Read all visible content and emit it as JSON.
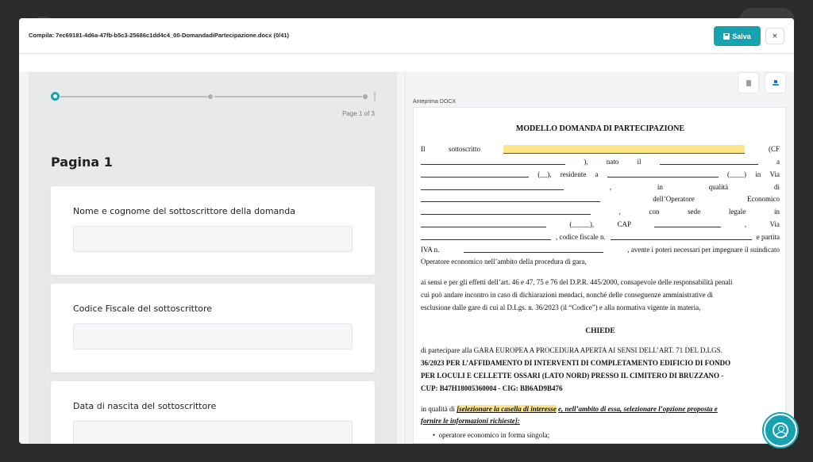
{
  "modal": {
    "title": "Compila: 7ec69181-4d6a-47fb-b5c3-25686c1dd4c4_00-DomandadiPartecipazione.docx (0/41)",
    "save_label": "Salva",
    "close_label": "×"
  },
  "form": {
    "page_counter": "Page 1 of 3",
    "page_heading": "Pagina 1",
    "fields": [
      {
        "label": "Nome e cognome del sottoscrittore della domanda",
        "value": ""
      },
      {
        "label": "Codice Fiscale del sottoscrittore",
        "value": ""
      },
      {
        "label": "Data di nascita del sottoscrittore",
        "value": ""
      }
    ]
  },
  "preview": {
    "label": "Anteprima DOCX",
    "doc_title": "MODELLO DOMANDA DI PARTECIPAZIONE",
    "l1_a": "Il",
    "l1_b": "sottoscritto",
    "l1_c": "(CF",
    "l2_a": "),",
    "l2_b": "nato",
    "l2_c": "il",
    "l2_d": "a",
    "l3_a": "(__),",
    "l3_b": "residente",
    "l3_c": "a",
    "l3_d": "(____)",
    "l3_e": "in",
    "l3_f": "Via",
    "l4_a": ",",
    "l4_b": "in",
    "l4_c": "qualità",
    "l4_d": "di",
    "l5_a": "dell’Operatore",
    "l5_b": "Economico",
    "l6_a": ",",
    "l6_b": "con",
    "l6_c": "sede",
    "l6_d": "legale",
    "l6_e": "in",
    "l7_a": "(_____),",
    "l7_b": "CAP",
    "l7_c": ",",
    "l7_d": "Via",
    "l8_a": ", codice fiscale n.",
    "l8_b": "e partita",
    "l9_a": "IVA n.",
    "l9_b": ", avente i poteri necessari per impegnare il suindicato",
    "l10": "Operatore economico nell’ambito della procedura di gara,",
    "p2_1": "ai sensi e per gli effetti dell’art. 46 e 47, 75 e 76 del D.P.R. 445/2000, consapevole delle responsabilità penali",
    "p2_2": "cui può andare incontro in caso di dichiarazioni mendaci, nonché delle conseguenze amministrative di",
    "p2_3": "esclusione dalle gare di cui al D.Lgs. n. 36/2023 (il “Codice”) e alla normativa vigente in materia,",
    "chiede": "CHIEDE",
    "p3_1": "di partecipare alla GARA EUROPEA A PROCEDURA APERTA AI SENSI DELL’ART. 71 DEL D.LGS.",
    "p3_2": "36/2023 PER L’AFFIDAMENTO DI INTERVENTI DI COMPLETAMENTO EDIFICIO DI FONDO",
    "p3_3": "PER LOCULI E CELLETTE OSSARI (LATO NORD) PRESSO IL CIMITERO DI BRUZZANO -",
    "p3_4": "CUP: B47H18005360004 - CIG: BB6AD9B476",
    "p4_a": "in qualità di",
    "p4_b": "[selezionare la casella di interesse",
    "p4_c": "e, nell’ambito di essa, selezionare l’opzione proposta e",
    "p4_2": "fornire le informazioni richieste]:",
    "bullet1": "operatore economico in forma singola;"
  }
}
